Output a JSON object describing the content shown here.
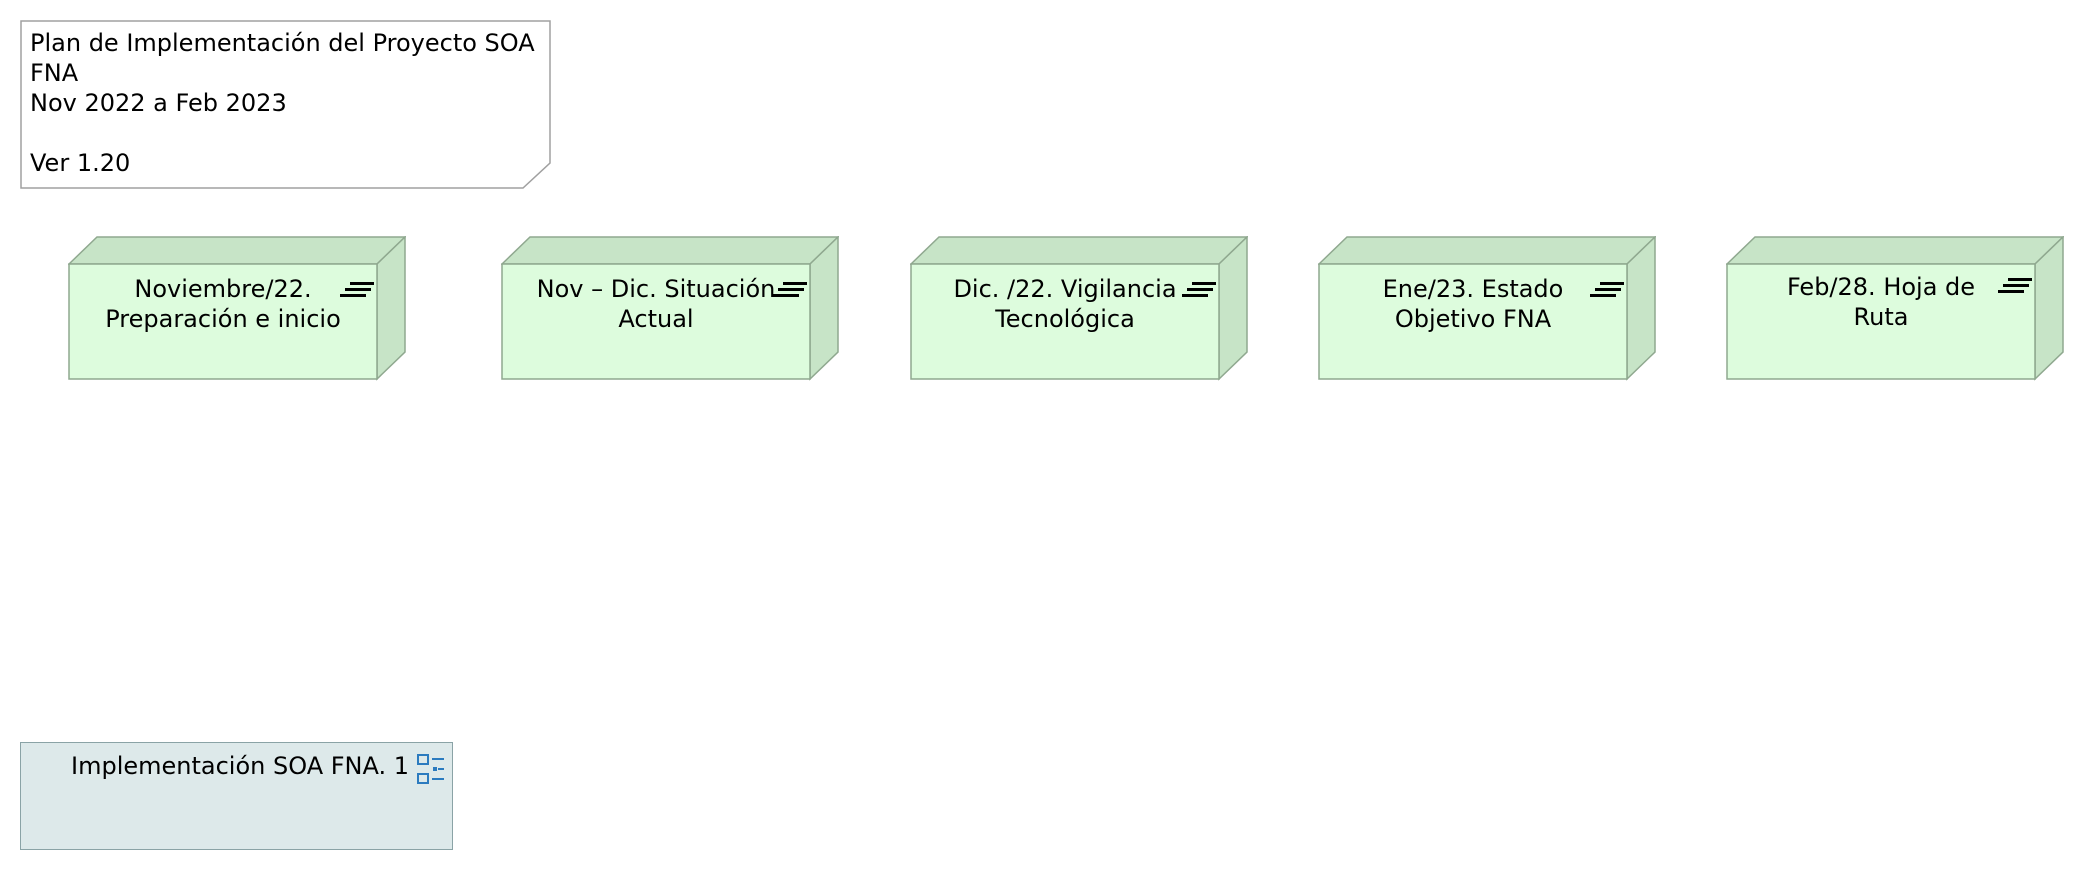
{
  "note": {
    "text": "Plan de Implementación del Proyecto SOA\nFNA\nNov 2022 a Feb 2023\n\nVer 1.20"
  },
  "nodes": [
    {
      "label": "Noviembre/22. Preparación e inicio",
      "icon": "work-package-icon"
    },
    {
      "label": "Nov – Dic. Situación Actual",
      "icon": "work-package-icon"
    },
    {
      "label": "Dic. /22. Vigilancia Tecnológica",
      "icon": "work-package-icon"
    },
    {
      "label": "Ene/23. Estado Objetivo FNA",
      "icon": "work-package-icon"
    },
    {
      "label": "Feb/28. Hoja de Ruta",
      "icon": "work-package-icon"
    }
  ],
  "plateau": {
    "label": "Implementación SOA FNA. 1",
    "icon": "grouping-icon"
  },
  "colors": {
    "node_face": "#ddfcdd",
    "node_side": "#c7e4c7",
    "node_stroke": "#8fa88f",
    "plateau_fill": "#dde9ea",
    "icon_blue": "#2b7bbf"
  }
}
